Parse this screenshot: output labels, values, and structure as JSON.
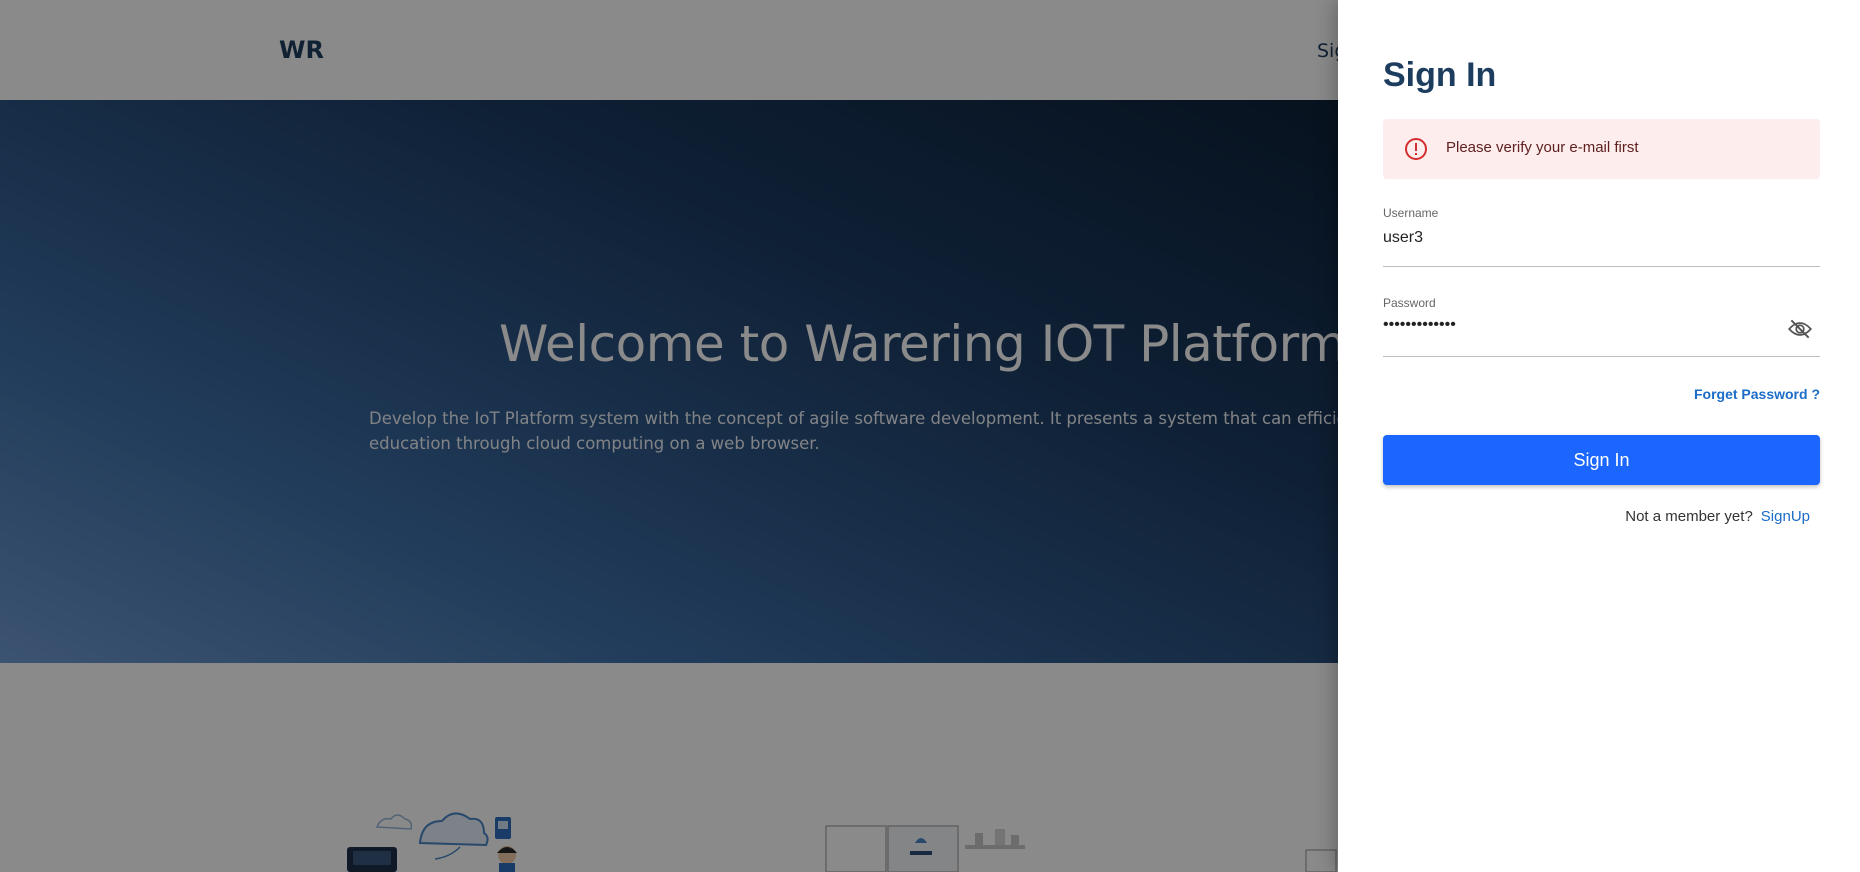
{
  "background": {
    "brand": "WR",
    "nav_partial": "Sig",
    "hero": {
      "title": "Welcome to Warering IOT Platform",
      "description": "Develop the IoT Platform system with the concept of agile software development. It presents a system that can efficiently provide I education through cloud computing on a web browser."
    },
    "illustrations": [
      "cloud-iot-illustration",
      "server-room-illustration",
      "partial-illustration"
    ]
  },
  "signin": {
    "title": "Sign In",
    "alert": {
      "icon": "error-icon",
      "message": "Please verify your e-mail first",
      "color": "#d32f2f"
    },
    "username": {
      "label": "Username",
      "value": "user3"
    },
    "password": {
      "label": "Password",
      "masked_value": "•••••••••••••",
      "toggle_icon": "eye-off-icon"
    },
    "forgot_label": "Forget Password ?",
    "submit_label": "Sign In",
    "member_prompt": "Not a member yet?",
    "signup_label": "SignUp"
  },
  "colors": {
    "primary_button": "#1a66ff",
    "link": "#1b6cc8",
    "heading": "#1d3d5e",
    "alert_bg": "#fdeded"
  }
}
